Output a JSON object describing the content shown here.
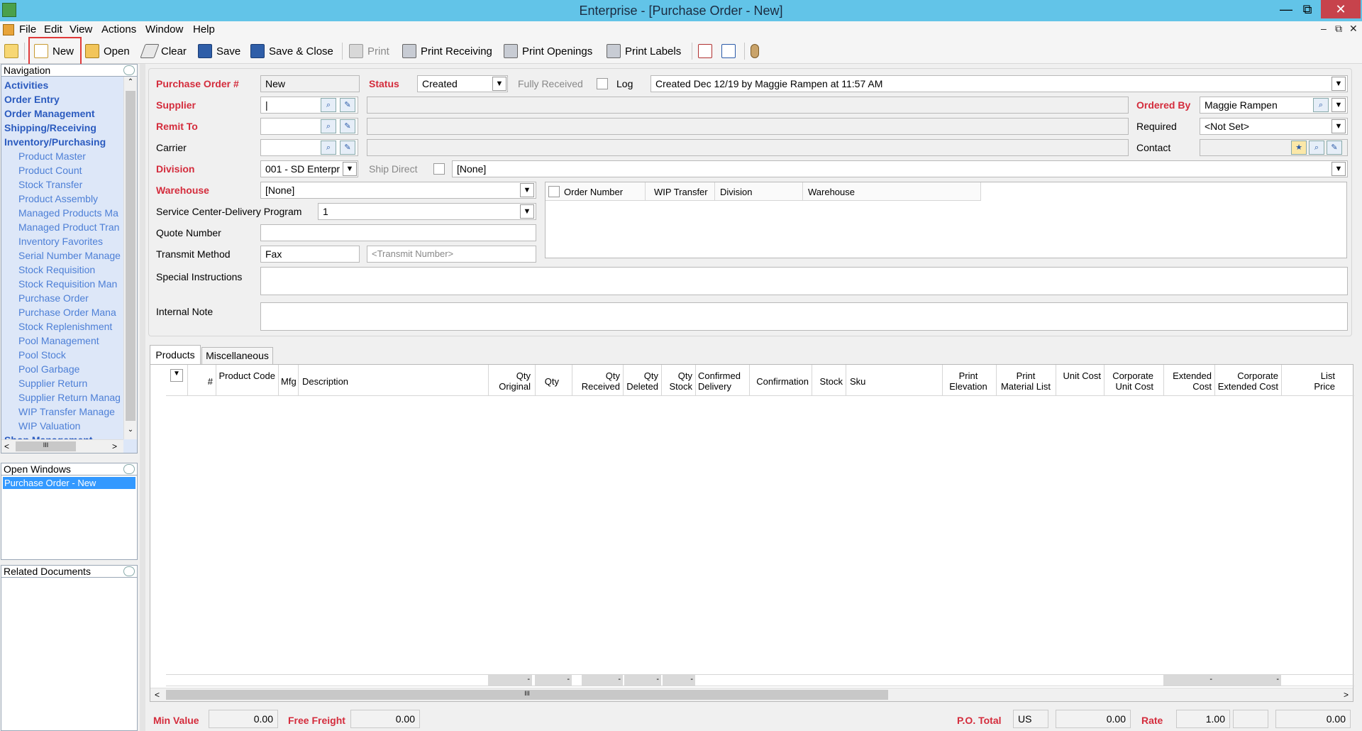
{
  "window": {
    "title": "Enterprise - [Purchase Order - New]"
  },
  "menu": [
    "File",
    "Edit",
    "View",
    "Actions",
    "Window",
    "Help"
  ],
  "toolbar": {
    "new": "New",
    "open": "Open",
    "clear": "Clear",
    "save": "Save",
    "save_close": "Save & Close",
    "print": "Print",
    "print_receiving": "Print Receiving",
    "print_openings": "Print Openings",
    "print_labels": "Print Labels"
  },
  "navigation": {
    "title": "Navigation",
    "categories": [
      "Activities",
      "Order Entry",
      "Order Management",
      "Shipping/Receiving",
      "Inventory/Purchasing"
    ],
    "items": [
      "Product Master",
      "Product Count",
      "Stock Transfer",
      "Product Assembly",
      "Managed Products Ma",
      "Managed Product Tran",
      "Inventory Favorites",
      "Serial Number Manage",
      "Stock Requisition",
      "Stock Requisition Man",
      "Purchase Order",
      "Purchase Order Mana",
      "Stock Replenishment",
      "Pool Management",
      "Pool Stock",
      "Pool Garbage",
      "Supplier Return",
      "Supplier Return Manag",
      "WIP Transfer Manage",
      "WIP Valuation"
    ],
    "next_category": "Shop Management",
    "scroll_thumb": "III"
  },
  "open_windows": {
    "title": "Open Windows",
    "items": [
      "Purchase Order - New"
    ]
  },
  "related_documents": {
    "title": "Related Documents"
  },
  "form": {
    "po_label": "Purchase Order #",
    "po_value": "New",
    "status_label": "Status",
    "status_value": "Created",
    "fully_received": "Fully Received",
    "log": "Log",
    "created_info": "Created Dec 12/19 by Maggie Rampen at 11:57 AM",
    "supplier_label": "Supplier",
    "remit_label": "Remit To",
    "carrier_label": "Carrier",
    "ordered_by_label": "Ordered By",
    "ordered_by_value": "Maggie Rampen",
    "required_label": "Required",
    "required_value": "<Not Set>",
    "contact_label": "Contact",
    "division_label": "Division",
    "division_value": "001 - SD Enterpr",
    "ship_direct": "Ship Direct",
    "ship_direct_value": "[None]",
    "warehouse_label": "Warehouse",
    "warehouse_value": "[None]",
    "service_label": "Service Center-Delivery Program",
    "service_value": "1",
    "quote_label": "Quote Number",
    "transmit_label": "Transmit Method",
    "transmit_value": "Fax",
    "transmit_number_placeholder": "<Transmit Number>",
    "special_label": "Special Instructions",
    "internal_label": "Internal Note"
  },
  "linked_grid": {
    "columns": [
      "Order Number",
      "WIP Transfer",
      "Division",
      "Warehouse"
    ]
  },
  "tabs": [
    "Products",
    "Miscellaneous"
  ],
  "products_grid": {
    "columns": [
      "#",
      "Product Code",
      "Mfg",
      "Description",
      "Qty Original",
      "Qty",
      "Qty Received",
      "Qty Deleted",
      "Qty Stock",
      "Confirmed Delivery",
      "Confirmation",
      "Stock",
      "Sku",
      "Print Elevation",
      "Print Material List",
      "Unit Cost",
      "Corporate Unit Cost",
      "Extended Cost",
      "Corporate Extended Cost",
      "List Price"
    ],
    "total_dash": "-",
    "scroll_thumb": "III"
  },
  "footer": {
    "min_value_label": "Min Value",
    "min_value": "0.00",
    "free_freight_label": "Free Freight",
    "free_freight": "0.00",
    "po_total_label": "P.O. Total",
    "currency": "US",
    "po_total": "0.00",
    "rate_label": "Rate",
    "rate": "1.00",
    "extra_total": "0.00"
  }
}
